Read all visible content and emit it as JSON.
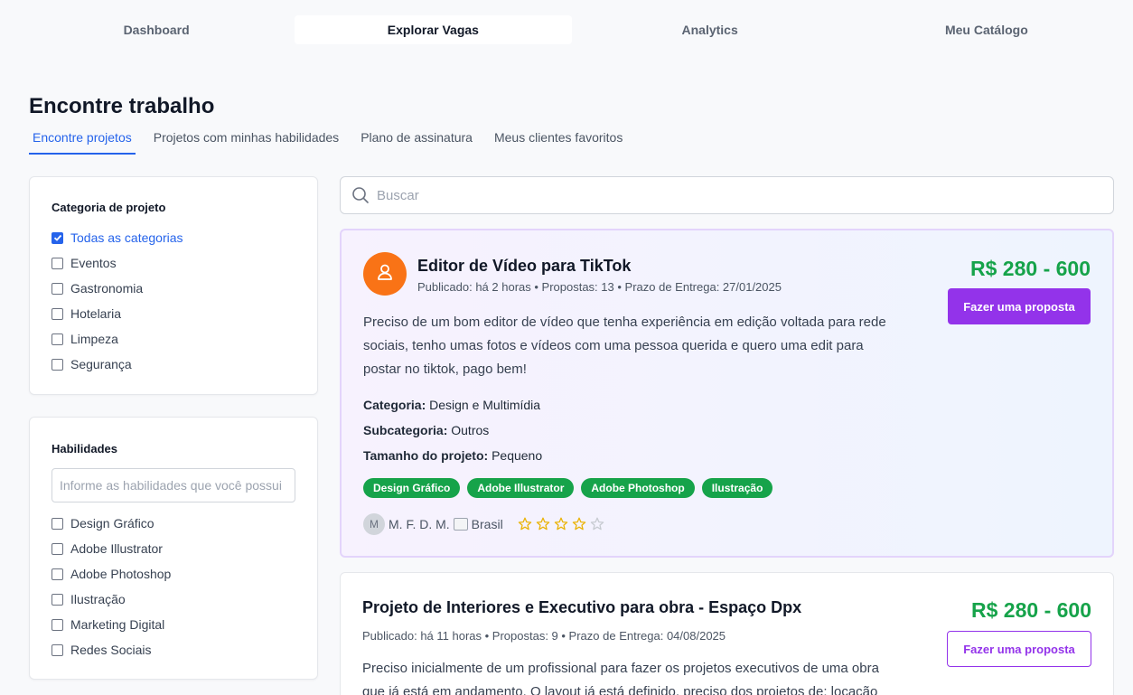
{
  "topnav": {
    "tabs": [
      {
        "label": "Dashboard"
      },
      {
        "label": "Explorar Vagas"
      },
      {
        "label": "Analytics"
      },
      {
        "label": "Meu Catálogo"
      }
    ],
    "active_index": 1
  },
  "page": {
    "title": "Encontre trabalho",
    "subtabs": [
      {
        "label": "Encontre projetos"
      },
      {
        "label": "Projetos com minhas habilidades"
      },
      {
        "label": "Plano de assinatura"
      },
      {
        "label": "Meus clientes favoritos"
      }
    ],
    "active_subtab": 0
  },
  "filters": {
    "category": {
      "title": "Categoria de projeto",
      "items": [
        {
          "label": "Todas as categorias",
          "checked": true
        },
        {
          "label": "Eventos",
          "checked": false
        },
        {
          "label": "Gastronomia",
          "checked": false
        },
        {
          "label": "Hotelaria",
          "checked": false
        },
        {
          "label": "Limpeza",
          "checked": false
        },
        {
          "label": "Segurança",
          "checked": false
        }
      ]
    },
    "skills": {
      "title": "Habilidades",
      "placeholder": "Informe as habilidades que você possui",
      "items": [
        {
          "label": "Design Gráfico",
          "checked": false
        },
        {
          "label": "Adobe Illustrator",
          "checked": false
        },
        {
          "label": "Adobe Photoshop",
          "checked": false
        },
        {
          "label": "Ilustração",
          "checked": false
        },
        {
          "label": "Marketing Digital",
          "checked": false
        },
        {
          "label": "Redes Sociais",
          "checked": false
        }
      ]
    }
  },
  "search": {
    "placeholder": "Buscar",
    "icon": "search-icon"
  },
  "jobs": [
    {
      "title": "Editor de Vídeo para TikTok",
      "meta": "Publicado: há 2 horas • Propostas: 13 • Prazo de Entrega: 27/01/2025",
      "price": "R$ 280 - 600",
      "button": "Fazer uma proposta",
      "desc_lines": [
        "Preciso de um bom editor de vídeo que tenha experiência em edição voltada para rede",
        "sociais, tenho umas fotos e vídeos com uma pessoa querida e quero uma edit para",
        "postar no tiktok, pago bem!"
      ],
      "category_label": "Categoria:",
      "category": "Design e Multimídia",
      "subcategory_label": "Subcategoria:",
      "subcategory": "Outros",
      "size_label": "Tamanho do projeto:",
      "size": "Pequeno",
      "tags": [
        "Design Gráfico",
        "Adobe Illustrator",
        "Adobe Photoshop",
        "Ilustração"
      ],
      "client_initial": "M",
      "client_name": "M. F. D. M.",
      "client_country": "Brasil",
      "rating": 4,
      "rating_max": 5,
      "featured": true
    },
    {
      "title": "Projeto de Interiores e Executivo para obra - Espaço Dpx",
      "meta": "Publicado: há 11 horas • Propostas: 9 • Prazo de Entrega: 04/08/2025",
      "price": "R$ 280 - 600",
      "button": "Fazer uma proposta",
      "desc_lines": [
        "Preciso inicialmente de um profissional para fazer os projetos executivos de uma obra",
        "que já está em andamento. O layout já está definido, preciso dos projetos de: locação"
      ],
      "featured": false
    }
  ],
  "colors": {
    "accent_blue": "#2563eb",
    "purple": "#9333ea",
    "green": "#16a34a",
    "orange": "#f97316",
    "star": "#eab308"
  }
}
